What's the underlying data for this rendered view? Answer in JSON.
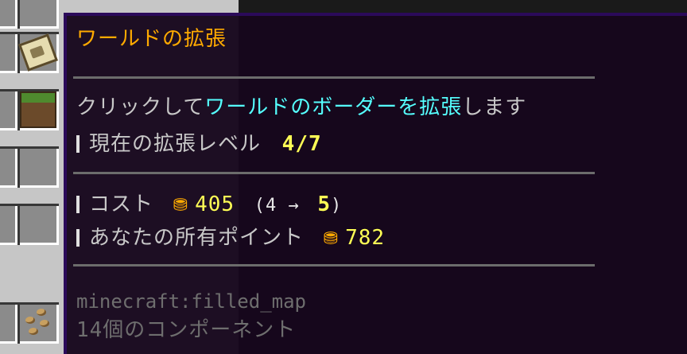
{
  "tooltip": {
    "title": "ワールドの拡張",
    "click_prefix": "クリックして",
    "click_highlight": "ワールドのボーダーを拡張",
    "click_suffix": "します",
    "current_label": "現在の拡張レベル",
    "current_value": "4/7",
    "cost_label": "コスト",
    "cost_amount": "405",
    "cost_paren_open": "(4 →",
    "cost_target": "5",
    "cost_paren_close": ")",
    "points_label": "あなたの所有ポイント",
    "points_amount": "782",
    "item_id": "minecraft:filled_map",
    "components": "14個のコンポーネント"
  },
  "icons": {
    "coin": "coin-pile-icon",
    "map": "filled-map-icon",
    "grass": "grass-block-icon",
    "seeds": "seeds-icon"
  },
  "colors": {
    "title": "#ffaa00",
    "highlight": "#55ffff",
    "value": "#ffff55",
    "body": "#c8c8c8",
    "meta": "#6e6e6e",
    "tooltip_bg": "#16061c",
    "tooltip_border": "#2b0a5a"
  }
}
